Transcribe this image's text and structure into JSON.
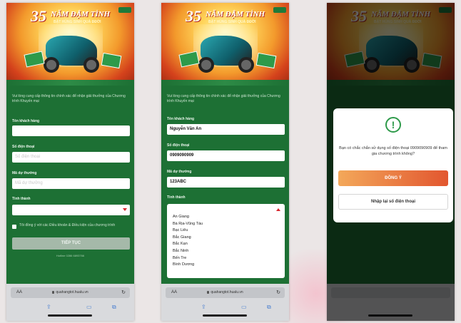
{
  "banner": {
    "big_number": "35",
    "title": "NĂM ĐẬM TÌNH",
    "subtitle": "BẬT HÙNG SINH QUÀ ĐĐỜI"
  },
  "colors": {
    "brand_green": "#1d7034",
    "accent_red": "#d8242b",
    "confirm_orange": "#e2562f"
  },
  "form": {
    "intro": "Vui lòng cung cấp thông tin chính xác để nhận giải thưởng của Chương trình Khuyến mại",
    "name_label": "Tên khách hàng",
    "phone_label": "Số điện thoại",
    "code_label": "Mã dự thưởng",
    "province_label": "Tỉnh thành",
    "phone_placeholder": "Số điện thoại",
    "code_placeholder": "Mã dự thưởng",
    "terms": "Tôi đồng ý với các Điều khoản & Điều kiện của chương trình",
    "submit": "TIẾP TỤC",
    "hotline": "Hotline 0286 6893766"
  },
  "filled": {
    "name": "Nguyễn Văn An",
    "phone": "0909090909",
    "code": "123ABC",
    "provinces": [
      "An Giang",
      "Bà Rịa-Vũng Tàu",
      "Bạc Liêu",
      "Bắc Giang",
      "Bắc Kạn",
      "Bắc Ninh",
      "Bến Tre",
      "Bình Dương"
    ]
  },
  "browser": {
    "aa": "AA",
    "url": "quahangtot.hualu.vn",
    "reload_icon": "reload-icon",
    "share_icon": "share-icon",
    "bookmarks_icon": "book-icon",
    "tabs_icon": "tabs-icon"
  },
  "dialog": {
    "message": "Bạn có chắc chắn sử dụng số điện thoại 0909090909 để tham gia chương trình không?",
    "confirm": "ĐỒNG Ý",
    "reenter": "Nhập lại số điện thoại"
  }
}
